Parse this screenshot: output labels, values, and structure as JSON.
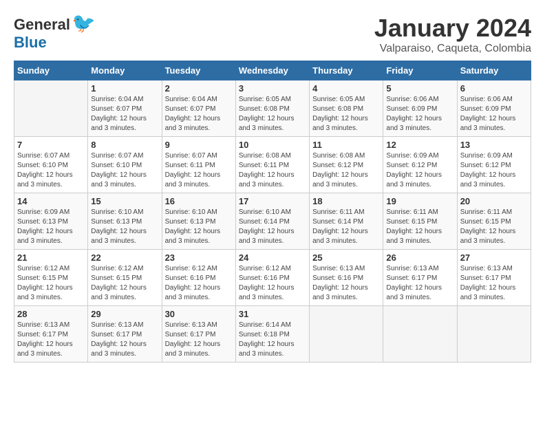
{
  "logo": {
    "general": "General",
    "blue": "Blue"
  },
  "title": "January 2024",
  "location": "Valparaiso, Caqueta, Colombia",
  "days_header": [
    "Sunday",
    "Monday",
    "Tuesday",
    "Wednesday",
    "Thursday",
    "Friday",
    "Saturday"
  ],
  "weeks": [
    [
      {
        "day": "",
        "info": ""
      },
      {
        "day": "1",
        "info": "Sunrise: 6:04 AM\nSunset: 6:07 PM\nDaylight: 12 hours\nand 3 minutes."
      },
      {
        "day": "2",
        "info": "Sunrise: 6:04 AM\nSunset: 6:07 PM\nDaylight: 12 hours\nand 3 minutes."
      },
      {
        "day": "3",
        "info": "Sunrise: 6:05 AM\nSunset: 6:08 PM\nDaylight: 12 hours\nand 3 minutes."
      },
      {
        "day": "4",
        "info": "Sunrise: 6:05 AM\nSunset: 6:08 PM\nDaylight: 12 hours\nand 3 minutes."
      },
      {
        "day": "5",
        "info": "Sunrise: 6:06 AM\nSunset: 6:09 PM\nDaylight: 12 hours\nand 3 minutes."
      },
      {
        "day": "6",
        "info": "Sunrise: 6:06 AM\nSunset: 6:09 PM\nDaylight: 12 hours\nand 3 minutes."
      }
    ],
    [
      {
        "day": "7",
        "info": "Sunrise: 6:07 AM\nSunset: 6:10 PM\nDaylight: 12 hours\nand 3 minutes."
      },
      {
        "day": "8",
        "info": "Sunrise: 6:07 AM\nSunset: 6:10 PM\nDaylight: 12 hours\nand 3 minutes."
      },
      {
        "day": "9",
        "info": "Sunrise: 6:07 AM\nSunset: 6:11 PM\nDaylight: 12 hours\nand 3 minutes."
      },
      {
        "day": "10",
        "info": "Sunrise: 6:08 AM\nSunset: 6:11 PM\nDaylight: 12 hours\nand 3 minutes."
      },
      {
        "day": "11",
        "info": "Sunrise: 6:08 AM\nSunset: 6:12 PM\nDaylight: 12 hours\nand 3 minutes."
      },
      {
        "day": "12",
        "info": "Sunrise: 6:09 AM\nSunset: 6:12 PM\nDaylight: 12 hours\nand 3 minutes."
      },
      {
        "day": "13",
        "info": "Sunrise: 6:09 AM\nSunset: 6:12 PM\nDaylight: 12 hours\nand 3 minutes."
      }
    ],
    [
      {
        "day": "14",
        "info": "Sunrise: 6:09 AM\nSunset: 6:13 PM\nDaylight: 12 hours\nand 3 minutes."
      },
      {
        "day": "15",
        "info": "Sunrise: 6:10 AM\nSunset: 6:13 PM\nDaylight: 12 hours\nand 3 minutes."
      },
      {
        "day": "16",
        "info": "Sunrise: 6:10 AM\nSunset: 6:13 PM\nDaylight: 12 hours\nand 3 minutes."
      },
      {
        "day": "17",
        "info": "Sunrise: 6:10 AM\nSunset: 6:14 PM\nDaylight: 12 hours\nand 3 minutes."
      },
      {
        "day": "18",
        "info": "Sunrise: 6:11 AM\nSunset: 6:14 PM\nDaylight: 12 hours\nand 3 minutes."
      },
      {
        "day": "19",
        "info": "Sunrise: 6:11 AM\nSunset: 6:15 PM\nDaylight: 12 hours\nand 3 minutes."
      },
      {
        "day": "20",
        "info": "Sunrise: 6:11 AM\nSunset: 6:15 PM\nDaylight: 12 hours\nand 3 minutes."
      }
    ],
    [
      {
        "day": "21",
        "info": "Sunrise: 6:12 AM\nSunset: 6:15 PM\nDaylight: 12 hours\nand 3 minutes."
      },
      {
        "day": "22",
        "info": "Sunrise: 6:12 AM\nSunset: 6:15 PM\nDaylight: 12 hours\nand 3 minutes."
      },
      {
        "day": "23",
        "info": "Sunrise: 6:12 AM\nSunset: 6:16 PM\nDaylight: 12 hours\nand 3 minutes."
      },
      {
        "day": "24",
        "info": "Sunrise: 6:12 AM\nSunset: 6:16 PM\nDaylight: 12 hours\nand 3 minutes."
      },
      {
        "day": "25",
        "info": "Sunrise: 6:13 AM\nSunset: 6:16 PM\nDaylight: 12 hours\nand 3 minutes."
      },
      {
        "day": "26",
        "info": "Sunrise: 6:13 AM\nSunset: 6:17 PM\nDaylight: 12 hours\nand 3 minutes."
      },
      {
        "day": "27",
        "info": "Sunrise: 6:13 AM\nSunset: 6:17 PM\nDaylight: 12 hours\nand 3 minutes."
      }
    ],
    [
      {
        "day": "28",
        "info": "Sunrise: 6:13 AM\nSunset: 6:17 PM\nDaylight: 12 hours\nand 3 minutes."
      },
      {
        "day": "29",
        "info": "Sunrise: 6:13 AM\nSunset: 6:17 PM\nDaylight: 12 hours\nand 3 minutes."
      },
      {
        "day": "30",
        "info": "Sunrise: 6:13 AM\nSunset: 6:17 PM\nDaylight: 12 hours\nand 3 minutes."
      },
      {
        "day": "31",
        "info": "Sunrise: 6:14 AM\nSunset: 6:18 PM\nDaylight: 12 hours\nand 3 minutes."
      },
      {
        "day": "",
        "info": ""
      },
      {
        "day": "",
        "info": ""
      },
      {
        "day": "",
        "info": ""
      }
    ]
  ]
}
